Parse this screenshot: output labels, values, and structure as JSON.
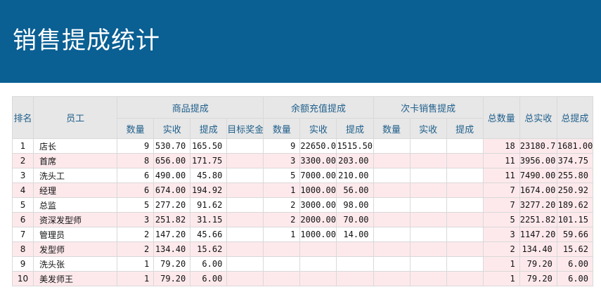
{
  "title": "销售提成统计",
  "colors": {
    "header_bg": "#0a5f93",
    "row_stripe": "#fde9ec",
    "header_text": "#1f5f8b"
  },
  "columns": {
    "rank": "排名",
    "employee": "员工",
    "goods": "商品提成",
    "recharge": "余额充值提成",
    "card": "次卡销售提成",
    "total_qty": "总数量",
    "total_received": "总实收",
    "total_commission": "总提成",
    "qty": "数量",
    "received": "实收",
    "commission": "提成",
    "target_bonus": "目标奖金"
  },
  "rows": [
    [
      "1",
      "店长",
      "9",
      "530.70",
      "165.50",
      "",
      "9",
      "22650.0",
      "1515.50",
      "",
      "",
      "",
      "18",
      "23180.7",
      "1681.00"
    ],
    [
      "2",
      "首席",
      "8",
      "656.00",
      "171.75",
      "",
      "3",
      "3300.00",
      "203.00",
      "",
      "",
      "",
      "11",
      "3956.00",
      "374.75"
    ],
    [
      "3",
      "洗头工",
      "6",
      "490.00",
      "45.80",
      "",
      "5",
      "7000.00",
      "210.00",
      "",
      "",
      "",
      "11",
      "7490.00",
      "255.80"
    ],
    [
      "4",
      "经理",
      "6",
      "674.00",
      "194.92",
      "",
      "1",
      "1000.00",
      "56.00",
      "",
      "",
      "",
      "7",
      "1674.00",
      "250.92"
    ],
    [
      "5",
      "总监",
      "5",
      "277.20",
      "91.62",
      "",
      "2",
      "3000.00",
      "98.00",
      "",
      "",
      "",
      "7",
      "3277.20",
      "189.62"
    ],
    [
      "6",
      "资深发型师",
      "3",
      "251.82",
      "31.15",
      "",
      "2",
      "2000.00",
      "70.00",
      "",
      "",
      "",
      "5",
      "2251.82",
      "101.15"
    ],
    [
      "7",
      "管理员",
      "2",
      "147.20",
      "45.66",
      "",
      "1",
      "1000.00",
      "14.00",
      "",
      "",
      "",
      "3",
      "1147.20",
      "59.66"
    ],
    [
      "8",
      "发型师",
      "2",
      "134.40",
      "15.62",
      "",
      "",
      "",
      "",
      "",
      "",
      "",
      "2",
      "134.40",
      "15.62"
    ],
    [
      "9",
      "洗头张",
      "1",
      "79.20",
      "6.00",
      "",
      "",
      "",
      "",
      "",
      "",
      "",
      "1",
      "79.20",
      "6.00"
    ],
    [
      "10",
      "美发师王",
      "1",
      "79.20",
      "6.00",
      "",
      "",
      "",
      "",
      "",
      "",
      "",
      "1",
      "79.20",
      "6.00"
    ]
  ]
}
